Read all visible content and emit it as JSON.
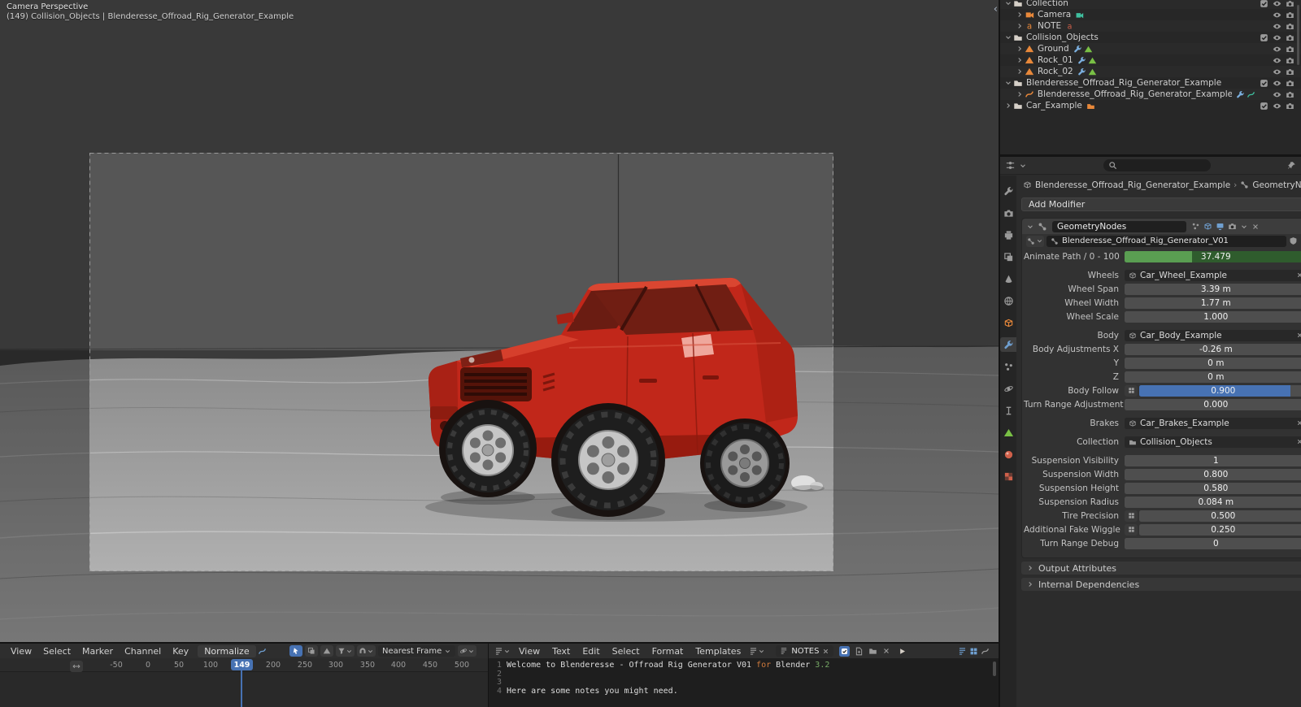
{
  "colors": {
    "accent": "#4772b3",
    "keyframe_green": "#5a9e52",
    "car_red": "#c1271a"
  },
  "icons": {
    "search": "magnifier",
    "close": "x-cross",
    "expand-open": "chevron-down",
    "expand-closed": "chevron-right",
    "hide": "eye",
    "camera-visibility": "camera",
    "exclude": "checkbox-checked",
    "modifier": "wrench",
    "mesh-data": "triangle",
    "curve-data": "curve",
    "collection": "box-folder",
    "decorator": "dot",
    "keyframe": "diamond",
    "attribute-toggle": "grid",
    "run-script": "play-triangle",
    "snap": "magnet",
    "filter": "funnel"
  },
  "viewport": {
    "view_label": "Camera Perspective",
    "context_label": "(149) Collision_Objects | Blenderesse_Offroad_Rig_Generator_Example",
    "collapse_arrow": "‹"
  },
  "outliner": {
    "rows": [
      {
        "label": "Collection",
        "icon": "collection"
      },
      {
        "label": "Camera",
        "icon": "camera-object"
      },
      {
        "label": "NOTE",
        "icon": "font-object"
      },
      {
        "label": "Collision_Objects",
        "icon": "collection"
      },
      {
        "label": "Ground",
        "icon": "mesh-object"
      },
      {
        "label": "Rock_01",
        "icon": "mesh-object"
      },
      {
        "label": "Rock_02",
        "icon": "mesh-object"
      },
      {
        "label": "Blenderesse_Offroad_Rig_Generator_Example",
        "icon": "collection"
      },
      {
        "label": "Blenderesse_Offroad_Rig_Generator_Example",
        "icon": "curve-object"
      },
      {
        "label": "Car_Example",
        "icon": "collection"
      }
    ]
  },
  "properties": {
    "breadcrumb": {
      "object": "Blenderesse_Offroad_Rig_Generator_Example",
      "tab": "GeometryNodes"
    },
    "add_modifier": "Add Modifier",
    "modifier": {
      "name": "GeometryNodes",
      "node_group": "Blenderesse_Offroad_Rig_Generator_V01"
    },
    "fields": [
      {
        "label": "Animate Path / 0 - 100",
        "value": "37.479"
      },
      {
        "label": "Wheels",
        "value": "Car_Wheel_Example"
      },
      {
        "label": "Wheel Span",
        "value": "3.39 m"
      },
      {
        "label": "Wheel Width",
        "value": "1.77 m"
      },
      {
        "label": "Wheel Scale",
        "value": "1.000"
      },
      {
        "label": "Body",
        "value": "Car_Body_Example"
      },
      {
        "label": "Body Adjustments X",
        "value": "-0.26 m"
      },
      {
        "label": "Y",
        "value": "0 m"
      },
      {
        "label": "Z",
        "value": "0 m"
      },
      {
        "label": "Body Follow",
        "value": "0.900"
      },
      {
        "label": "Turn Range Adjustment",
        "value": "0.000"
      },
      {
        "label": "Brakes",
        "value": "Car_Brakes_Example"
      },
      {
        "label": "Collection",
        "value": "Collision_Objects"
      },
      {
        "label": "Suspension Visibility",
        "value": "1"
      },
      {
        "label": "Suspension Width",
        "value": "0.800"
      },
      {
        "label": "Suspension Height",
        "value": "0.580"
      },
      {
        "label": "Suspension Radius",
        "value": "0.084 m"
      },
      {
        "label": "Tire Precision",
        "value": "0.500"
      },
      {
        "label": "Additional Fake Wiggle",
        "value": "0.250"
      },
      {
        "label": "Turn Range Debug",
        "value": "0"
      }
    ],
    "sections": [
      {
        "label": "Output Attributes"
      },
      {
        "label": "Internal Dependencies"
      }
    ]
  },
  "timeline": {
    "menus": [
      "View",
      "Select",
      "Marker",
      "Channel",
      "Key"
    ],
    "normalize": "Normalize",
    "snap": "Nearest Frame",
    "ticks": [
      "-50",
      "0",
      "50",
      "100",
      "200",
      "250",
      "300",
      "350",
      "400",
      "450",
      "500"
    ],
    "current_frame": "149"
  },
  "text_editor": {
    "menus": [
      "View",
      "Text",
      "Edit",
      "Select",
      "Format",
      "Templates"
    ],
    "datablock": "NOTES",
    "line_numbers": [
      "1",
      "2",
      "3",
      "4"
    ],
    "line1": {
      "a": "Welcome to Blenderesse - Offroad Rig Generator V01 ",
      "kw": "for",
      "b": " Blender ",
      "num": "3.2"
    },
    "line4": "Here are some notes you might need."
  }
}
